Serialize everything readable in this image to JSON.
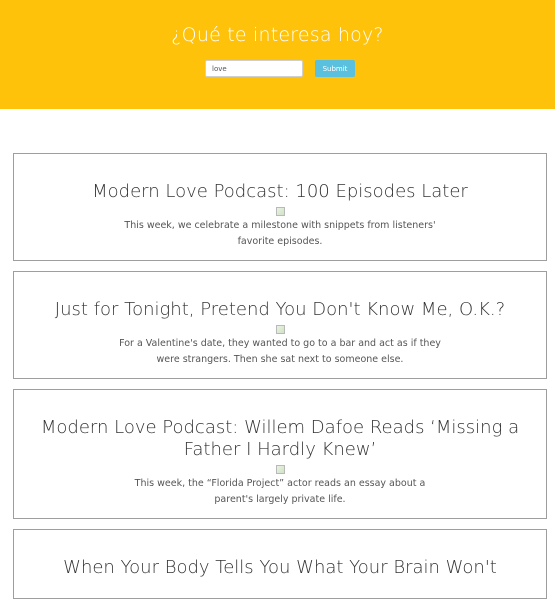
{
  "header": {
    "title": "¿Qué te interesa hoy?",
    "search_value": "love",
    "submit_label": "Submit"
  },
  "colors": {
    "header_bg": "#fec20b",
    "submit_bg": "#5bc0de"
  },
  "articles": [
    {
      "title": "Modern Love Podcast: 100 Episodes Later",
      "summary": "This week, we celebrate a milestone with snippets from listeners' favorite episodes."
    },
    {
      "title": "Just for Tonight, Pretend You Don't Know Me, O.K.?",
      "summary": "For a Valentine's date, they wanted to go to a bar and act as if they were strangers. Then she sat next to someone else."
    },
    {
      "title": "Modern Love Podcast: Willem Dafoe Reads ‘Missing a Father I Hardly Knew’",
      "summary": "This week, the “Florida Project” actor reads an essay about a parent's largely private life."
    },
    {
      "title": "When Your Body Tells You What Your Brain Won't",
      "summary": ""
    }
  ]
}
